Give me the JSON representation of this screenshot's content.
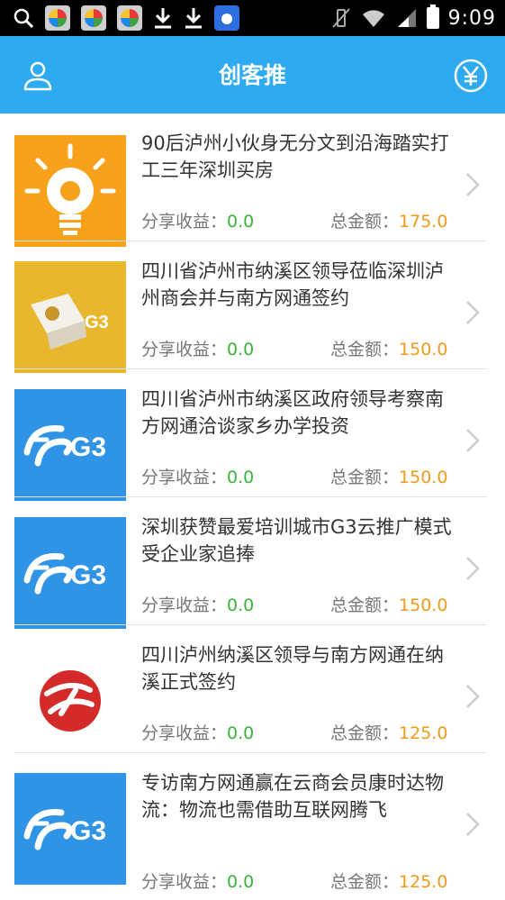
{
  "status_bar": {
    "time": "9:09"
  },
  "header": {
    "title": "创客推"
  },
  "articles": [
    {
      "title": "90后泸州小伙身无分文到沿海踏实打工三年深圳买房",
      "share_label": "分享收益：",
      "share_value": "0.0",
      "total_label": "总金额：",
      "total_value": "175.0",
      "thumb": "bulb-icon"
    },
    {
      "title": "四川省泸州市纳溪区领导莅临深圳泸州商会并与南方网通签约",
      "share_label": "分享收益：",
      "share_value": "0.0",
      "total_label": "总金额：",
      "total_value": "150.0",
      "thumb": "g3-box-icon"
    },
    {
      "title": "四川省泸州市纳溪区政府领导考察南方网通洽谈家乡办学投资",
      "share_label": "分享收益：",
      "share_value": "0.0",
      "total_label": "总金额：",
      "total_value": "150.0",
      "thumb": "g3-logo"
    },
    {
      "title": "深圳获赞最爱培训城市G3云推广模式受企业家追捧",
      "share_label": "分享收益：",
      "share_value": "0.0",
      "total_label": "总金额：",
      "total_value": "150.0",
      "thumb": "g3-logo"
    },
    {
      "title": "四川泸州纳溪区领导与南方网通在纳溪正式签约",
      "share_label": "分享收益：",
      "share_value": "0.0",
      "total_label": "总金额：",
      "total_value": "125.0",
      "thumb": "red-logo"
    },
    {
      "title": "专访南方网通赢在云商会员康时达物流：物流也需借助互联网腾飞",
      "share_label": "分享收益：",
      "share_value": "0.0",
      "total_label": "总金额：",
      "total_value": "125.0",
      "thumb": "g3-logo"
    }
  ],
  "colors": {
    "header_bg": "#2eaaf0",
    "share_value": "#3bb33b",
    "total_value": "#f09a1a"
  }
}
